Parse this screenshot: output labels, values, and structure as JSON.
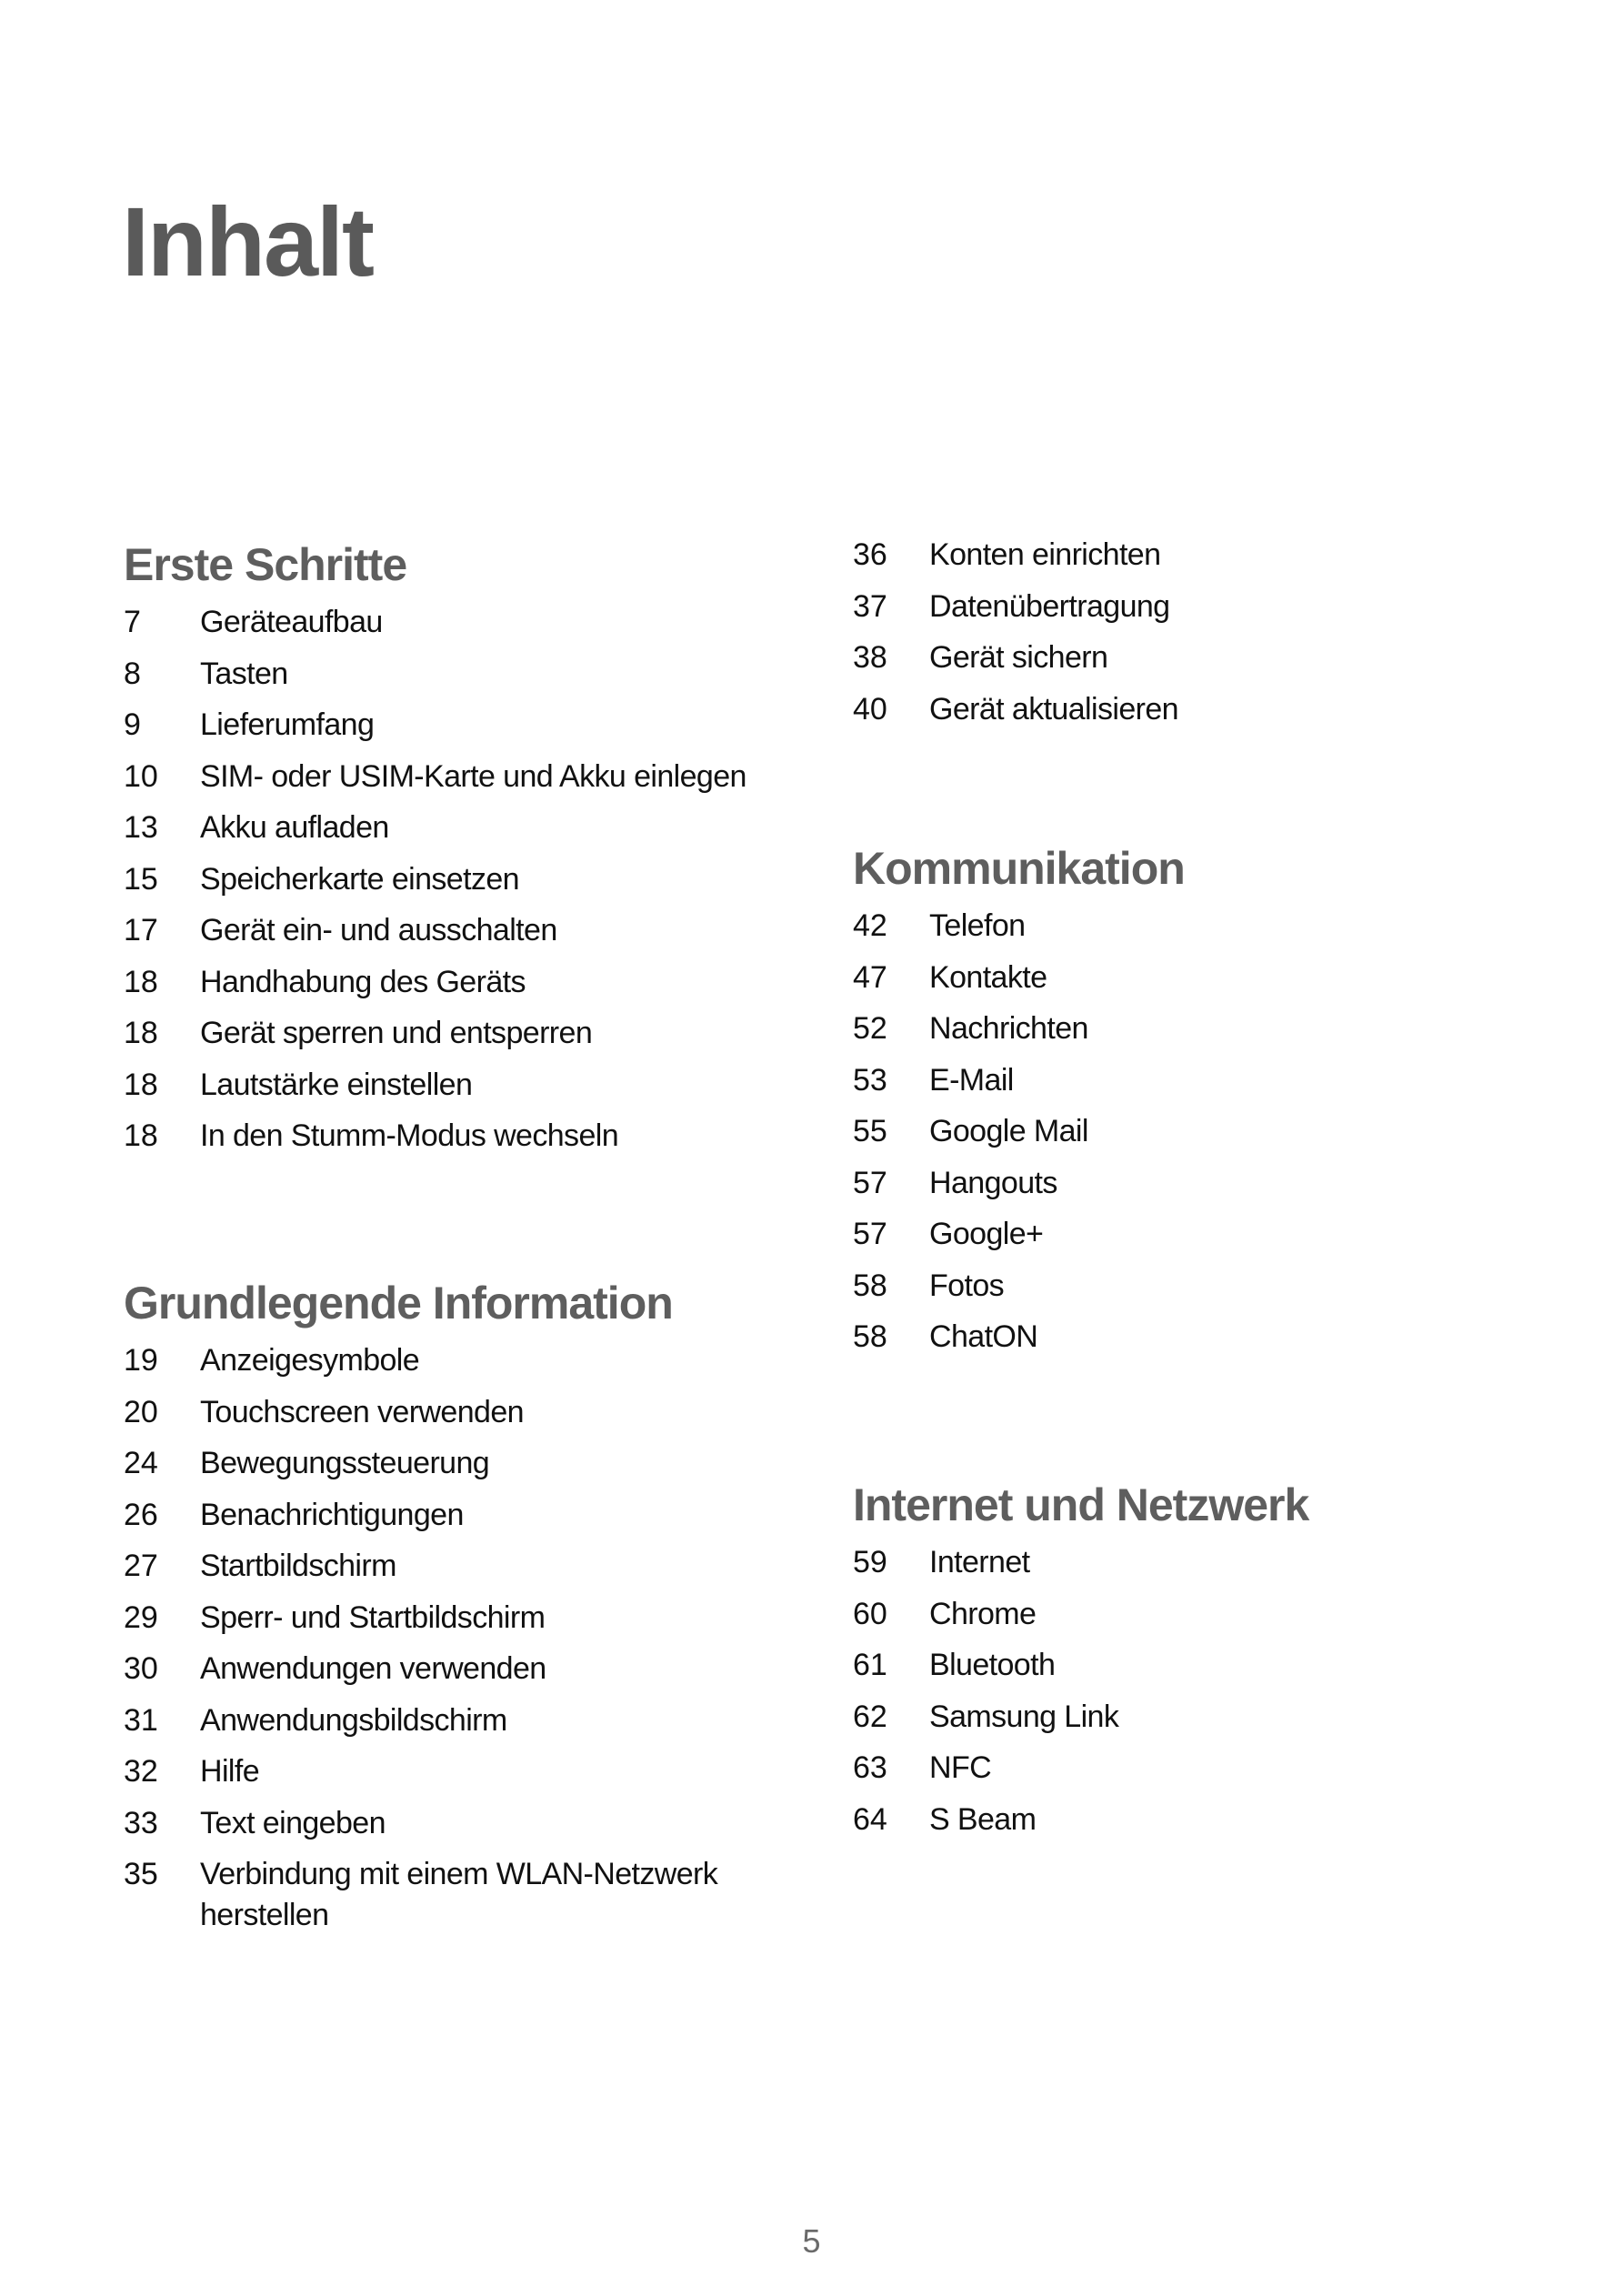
{
  "document": {
    "title": "Inhalt",
    "page_number": "5"
  },
  "colors": {
    "heading": "#5e5e5e",
    "title": "#5a5a5a",
    "body_text": "#111111",
    "page_number": "#6a6a6a"
  },
  "sections": {
    "erste_schritte": {
      "heading": "Erste Schritte",
      "items": [
        {
          "page": "7",
          "label": "Geräteaufbau"
        },
        {
          "page": "8",
          "label": "Tasten"
        },
        {
          "page": "9",
          "label": "Lieferumfang"
        },
        {
          "page": "10",
          "label": "SIM- oder USIM-Karte und Akku einlegen"
        },
        {
          "page": "13",
          "label": "Akku aufladen"
        },
        {
          "page": "15",
          "label": "Speicherkarte einsetzen"
        },
        {
          "page": "17",
          "label": "Gerät ein- und ausschalten"
        },
        {
          "page": "18",
          "label": "Handhabung des Geräts"
        },
        {
          "page": "18",
          "label": "Gerät sperren und entsperren"
        },
        {
          "page": "18",
          "label": "Lautstärke einstellen"
        },
        {
          "page": "18",
          "label": "In den Stumm-Modus wechseln"
        }
      ]
    },
    "grundlegende_information": {
      "heading": "Grundlegende Information",
      "items": [
        {
          "page": "19",
          "label": "Anzeigesymbole"
        },
        {
          "page": "20",
          "label": "Touchscreen verwenden"
        },
        {
          "page": "24",
          "label": "Bewegungssteuerung"
        },
        {
          "page": "26",
          "label": "Benachrichtigungen"
        },
        {
          "page": "27",
          "label": "Startbildschirm"
        },
        {
          "page": "29",
          "label": "Sperr- und Startbildschirm"
        },
        {
          "page": "30",
          "label": "Anwendungen verwenden"
        },
        {
          "page": "31",
          "label": "Anwendungsbildschirm"
        },
        {
          "page": "32",
          "label": "Hilfe"
        },
        {
          "page": "33",
          "label": "Text eingeben"
        },
        {
          "page": "35",
          "label": "Verbindung mit einem WLAN-Netzwerk herstellen"
        }
      ]
    },
    "grundlegende_information_cont": {
      "items": [
        {
          "page": "36",
          "label": "Konten einrichten"
        },
        {
          "page": "37",
          "label": "Datenübertragung"
        },
        {
          "page": "38",
          "label": "Gerät sichern"
        },
        {
          "page": "40",
          "label": "Gerät aktualisieren"
        }
      ]
    },
    "kommunikation": {
      "heading": "Kommunikation",
      "items": [
        {
          "page": "42",
          "label": "Telefon"
        },
        {
          "page": "47",
          "label": "Kontakte"
        },
        {
          "page": "52",
          "label": "Nachrichten"
        },
        {
          "page": "53",
          "label": "E-Mail"
        },
        {
          "page": "55",
          "label": "Google Mail"
        },
        {
          "page": "57",
          "label": "Hangouts"
        },
        {
          "page": "57",
          "label": "Google+"
        },
        {
          "page": "58",
          "label": "Fotos"
        },
        {
          "page": "58",
          "label": "ChatON"
        }
      ]
    },
    "internet_und_netzwerk": {
      "heading": "Internet und Netzwerk",
      "items": [
        {
          "page": "59",
          "label": "Internet"
        },
        {
          "page": "60",
          "label": "Chrome"
        },
        {
          "page": "61",
          "label": "Bluetooth"
        },
        {
          "page": "62",
          "label": "Samsung Link"
        },
        {
          "page": "63",
          "label": "NFC"
        },
        {
          "page": "64",
          "label": "S Beam"
        }
      ]
    }
  }
}
